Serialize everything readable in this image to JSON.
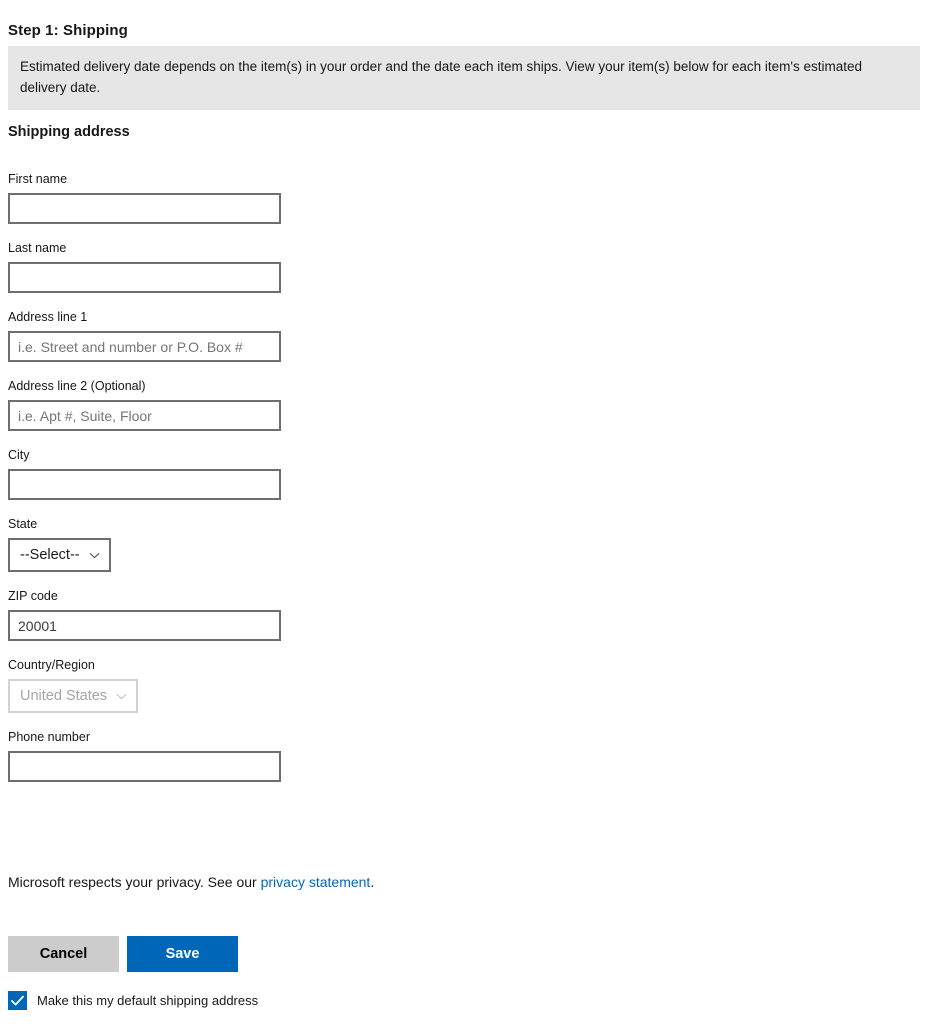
{
  "step": {
    "title": "Step 1: Shipping",
    "banner_text": "Estimated delivery date depends on the item(s) in your order and the date each item ships. View your item(s) below for each item's estimated delivery date."
  },
  "section": {
    "title": "Shipping address"
  },
  "fields": {
    "first_name": {
      "label": "First name",
      "value": "",
      "placeholder": ""
    },
    "last_name": {
      "label": "Last name",
      "value": "",
      "placeholder": ""
    },
    "address_line_1": {
      "label": "Address line 1",
      "value": "",
      "placeholder": "i.e. Street and number or P.O. Box #"
    },
    "address_line_2": {
      "label": "Address line 2 (Optional)",
      "value": "",
      "placeholder": "i.e. Apt #, Suite, Floor"
    },
    "city": {
      "label": "City",
      "value": "",
      "placeholder": ""
    },
    "state": {
      "label": "State",
      "selected": "--Select--",
      "options": [
        "--Select--"
      ]
    },
    "zip_code": {
      "label": "ZIP code",
      "value": "20001",
      "placeholder": ""
    },
    "country_region": {
      "label": "Country/Region",
      "selected": "United States",
      "options": [
        "United States"
      ],
      "disabled": true
    },
    "phone_number": {
      "label": "Phone number",
      "value": "",
      "placeholder": ""
    }
  },
  "privacy": {
    "text_before": "Microsoft respects your privacy. See our ",
    "link_text": "privacy statement",
    "text_after": "."
  },
  "buttons": {
    "cancel_label": "Cancel",
    "save_label": "Save"
  },
  "default_address_checkbox": {
    "label": "Make this my default shipping address",
    "checked": true
  },
  "colors": {
    "accent": "#0067b8",
    "banner_bg": "#e6e6e6",
    "cancel_bg": "#cccccc",
    "input_border": "#6e6e6e",
    "disabled_text": "#a6a6a6"
  }
}
